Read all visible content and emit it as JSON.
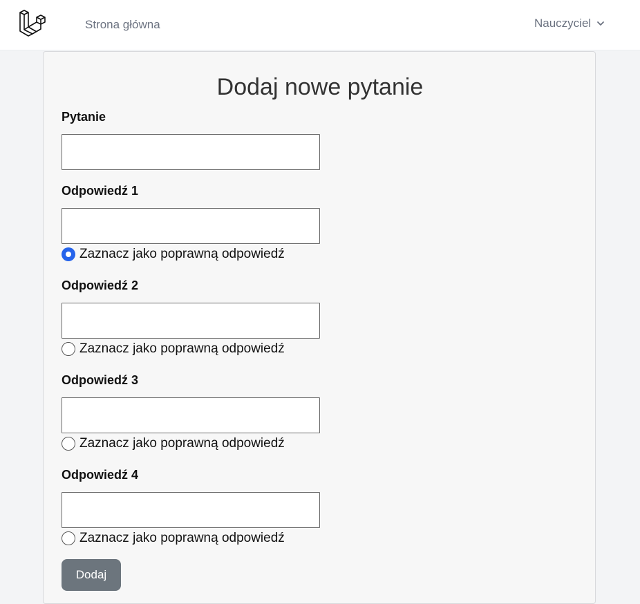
{
  "navbar": {
    "logo_icon": "laravel-logo-icon",
    "home_link": "Strona główna",
    "user_menu": "Nauczyciel",
    "user_menu_icon": "chevron-down-icon"
  },
  "form": {
    "title": "Dodaj nowe pytanie",
    "question": {
      "label": "Pytanie",
      "value": ""
    },
    "answers": [
      {
        "label": "Odpowiedź 1",
        "value": "",
        "radio_label": "Zaznacz jako poprawną odpowiedź",
        "checked": true
      },
      {
        "label": "Odpowiedź 2",
        "value": "",
        "radio_label": "Zaznacz jako poprawną odpowiedź",
        "checked": false
      },
      {
        "label": "Odpowiedź 3",
        "value": "",
        "radio_label": "Zaznacz jako poprawną odpowiedź",
        "checked": false
      },
      {
        "label": "Odpowiedź 4",
        "value": "",
        "radio_label": "Zaznacz jako poprawną odpowiedź",
        "checked": false
      }
    ],
    "submit_label": "Dodaj"
  },
  "colors": {
    "accent": "#2563eb",
    "button": "#6c757d",
    "page_bg": "#f3f4f6",
    "card_bg": "#f7f7f7"
  }
}
